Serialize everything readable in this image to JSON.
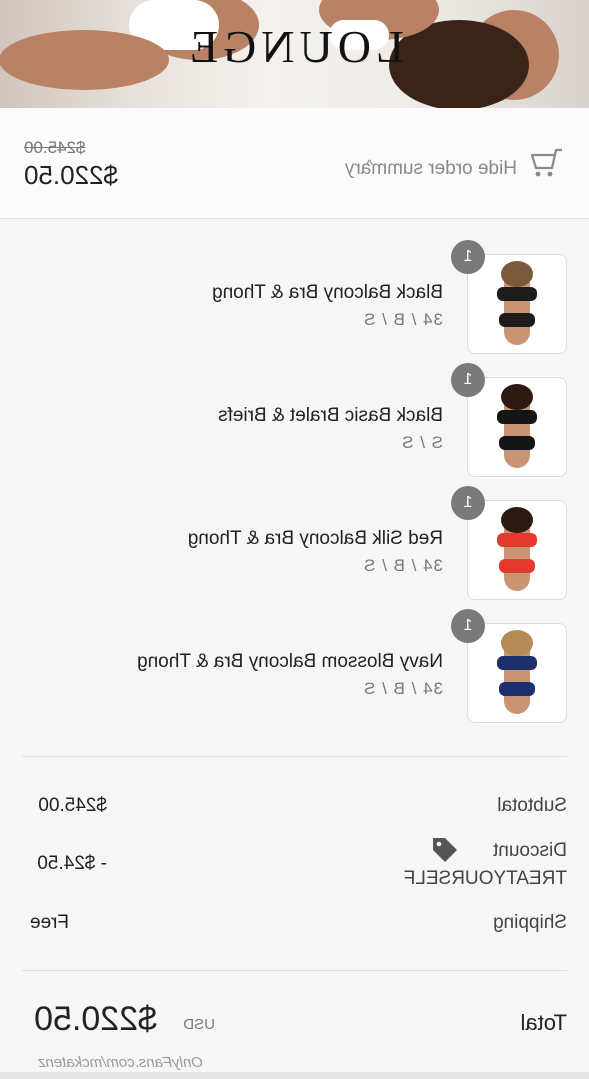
{
  "header": {
    "brand": "LOUNGE",
    "hide_summary_label": "Hide order summary",
    "chevron": "^",
    "original_total": "$245.00",
    "total": "$220.50"
  },
  "items": [
    {
      "quantity": "1",
      "name": "Black Balcony Bra & Thong",
      "variant": "34 / B / S",
      "colors": {
        "top": "#1d1d1d",
        "bottom": "#1d1d1d",
        "hair": "#7a5a3a"
      }
    },
    {
      "quantity": "1",
      "name": "Black Basic Bralet & Briefs",
      "variant": "S / S",
      "colors": {
        "top": "#151515",
        "bottom": "#151515",
        "hair": "#2a1a12"
      }
    },
    {
      "quantity": "1",
      "name": "Red Silk Balcony Bra & Thong",
      "variant": "34 / B / S",
      "colors": {
        "top": "#e23a2e",
        "bottom": "#e23a2e",
        "hair": "#2a1a12"
      }
    },
    {
      "quantity": "1",
      "name": "Navy Blossom Balcony Bra & Thong",
      "variant": "34 / B / S",
      "colors": {
        "top": "#1e2f6e",
        "bottom": "#1e2f6e",
        "hair": "#b48a55"
      }
    }
  ],
  "totals": {
    "subtotal_label": "Subtotal",
    "subtotal_value": "$245.00",
    "discount_label": "Discount",
    "discount_code": "TREATYOURSELF",
    "discount_value": "- $24.50",
    "shipping_label": "Shipping",
    "shipping_value": "Free",
    "total_label": "Total",
    "currency": "USD",
    "total_value": "$220.50"
  },
  "watermark": "OnlyFans.com/mckatenz",
  "icons": {
    "cart": "cart-icon",
    "tag": "tag-icon"
  }
}
